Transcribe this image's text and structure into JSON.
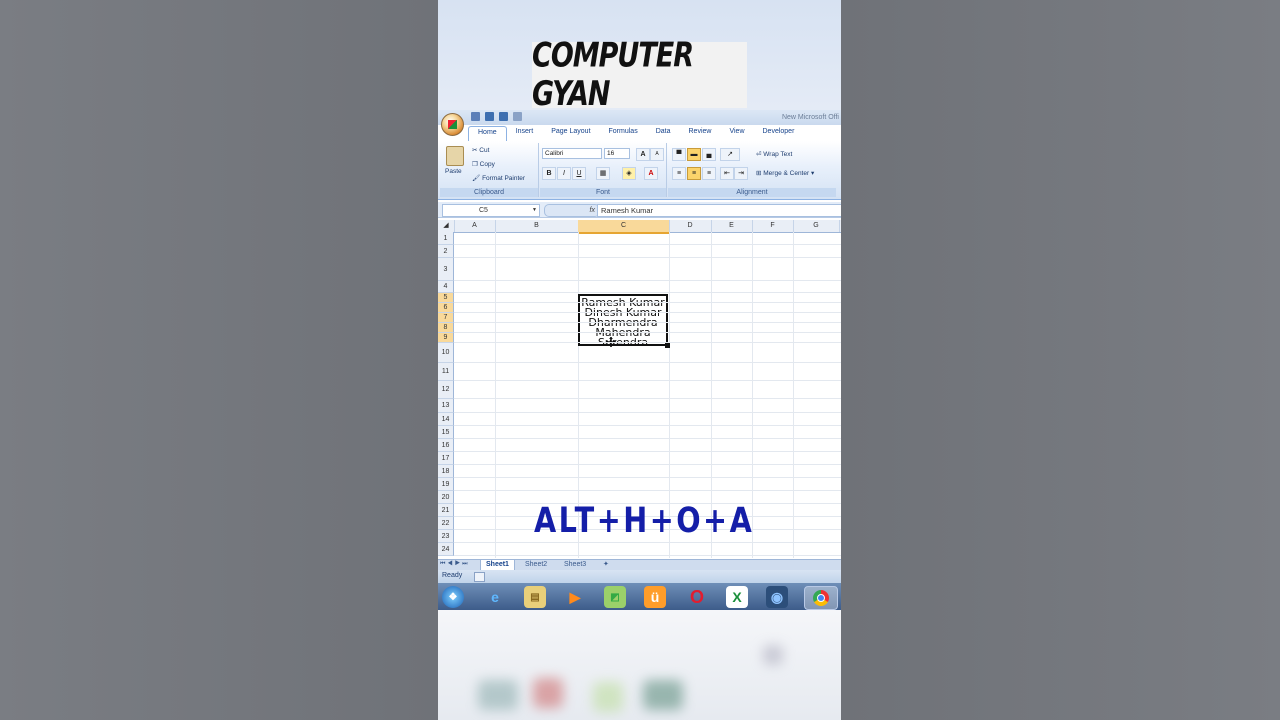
{
  "overlay": {
    "title": "COMPUTER GYAN",
    "shortcut": "ALT+H+O+A"
  },
  "excel": {
    "window_title": "New Microsoft Offi",
    "tabs": [
      "Home",
      "Insert",
      "Page Layout",
      "Formulas",
      "Data",
      "Review",
      "View",
      "Developer"
    ],
    "active_tab": "Home",
    "clipboard": {
      "paste": "Paste",
      "cut": "Cut",
      "copy": "Copy",
      "format_painter": "Format Painter",
      "label": "Clipboard"
    },
    "font": {
      "name": "Calibri",
      "size": "16",
      "bold": "B",
      "italic": "I",
      "underline": "U",
      "grow": "A",
      "shrink": "A",
      "font_color": "A",
      "label": "Font"
    },
    "alignment": {
      "wrap_text": "Wrap Text",
      "merge_center": "Merge & Center",
      "label": "Alignment"
    },
    "formula_bar": {
      "name_box": "C5",
      "fx": "fx",
      "value": "Ramesh Kumar"
    },
    "columns": [
      "A",
      "B",
      "C",
      "D",
      "E",
      "F",
      "G"
    ],
    "selected_column": "C",
    "rows": [
      "1",
      "2",
      "3",
      "4",
      "5",
      "6",
      "7",
      "8",
      "9",
      "10",
      "11",
      "12",
      "13",
      "14",
      "15",
      "16",
      "17",
      "18",
      "19",
      "20",
      "21",
      "22",
      "23",
      "24"
    ],
    "selected_rows": [
      "5",
      "6",
      "7",
      "8",
      "9"
    ],
    "selected_cell_lines": [
      "Ramesh Kumar",
      "Dinesh Kumar",
      "Dharmendra",
      "Mahendra",
      "Surendra"
    ],
    "sheets": [
      "Sheet1",
      "Sheet2",
      "Sheet3"
    ],
    "active_sheet": "Sheet1",
    "status": "Ready"
  },
  "taskbar": {
    "icons": [
      "start-orb-icon",
      "internet-explorer-icon",
      "file-explorer-icon",
      "media-player-icon",
      "paint-icon",
      "uc-browser-icon",
      "opera-icon",
      "excel-icon",
      "media-center-icon",
      "chrome-icon"
    ]
  }
}
